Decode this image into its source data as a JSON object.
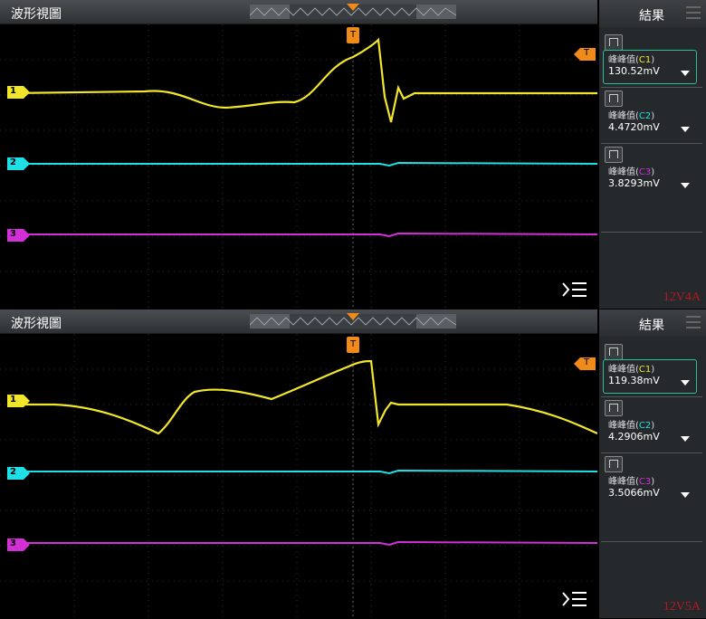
{
  "panels": [
    {
      "window_title": "波形視圖",
      "results_title": "結果",
      "measurements": [
        {
          "label_prefix": "峰峰值(",
          "channel": "C1",
          "label_suffix": ")",
          "value": "130.52mV",
          "channel_color": "#f2e62a"
        },
        {
          "label_prefix": "峰峰值(",
          "channel": "C2",
          "label_suffix": ")",
          "value": "4.4720mV",
          "channel_color": "#1ee0e6"
        },
        {
          "label_prefix": "峰峰值(",
          "channel": "C3",
          "label_suffix": ")",
          "value": "3.8293mV",
          "channel_color": "#d22fd6"
        }
      ],
      "channel_markers": [
        "1",
        "2",
        "3"
      ],
      "trigger_label": "T",
      "annotation": "12V4A"
    },
    {
      "window_title": "波形視圖",
      "results_title": "結果",
      "measurements": [
        {
          "label_prefix": "峰峰值(",
          "channel": "C1",
          "label_suffix": ")",
          "value": "119.38mV",
          "channel_color": "#f2e62a"
        },
        {
          "label_prefix": "峰峰值(",
          "channel": "C2",
          "label_suffix": ")",
          "value": "4.2906mV",
          "channel_color": "#1ee0e6"
        },
        {
          "label_prefix": "峰峰值(",
          "channel": "C3",
          "label_suffix": ")",
          "value": "3.5066mV",
          "channel_color": "#d22fd6"
        }
      ],
      "channel_markers": [
        "1",
        "2",
        "3"
      ],
      "trigger_label": "T",
      "annotation": "12V5A"
    }
  ],
  "colors": {
    "ch1": "#f2e62a",
    "ch2": "#1ee0e6",
    "ch3": "#d22fd6",
    "trigger": "#f08a18",
    "selected": "#2bbf9a"
  },
  "icons": {
    "menu": "menu-icon",
    "zoom": "zoom-lines-icon",
    "measure": "pulse-measure-icon"
  }
}
